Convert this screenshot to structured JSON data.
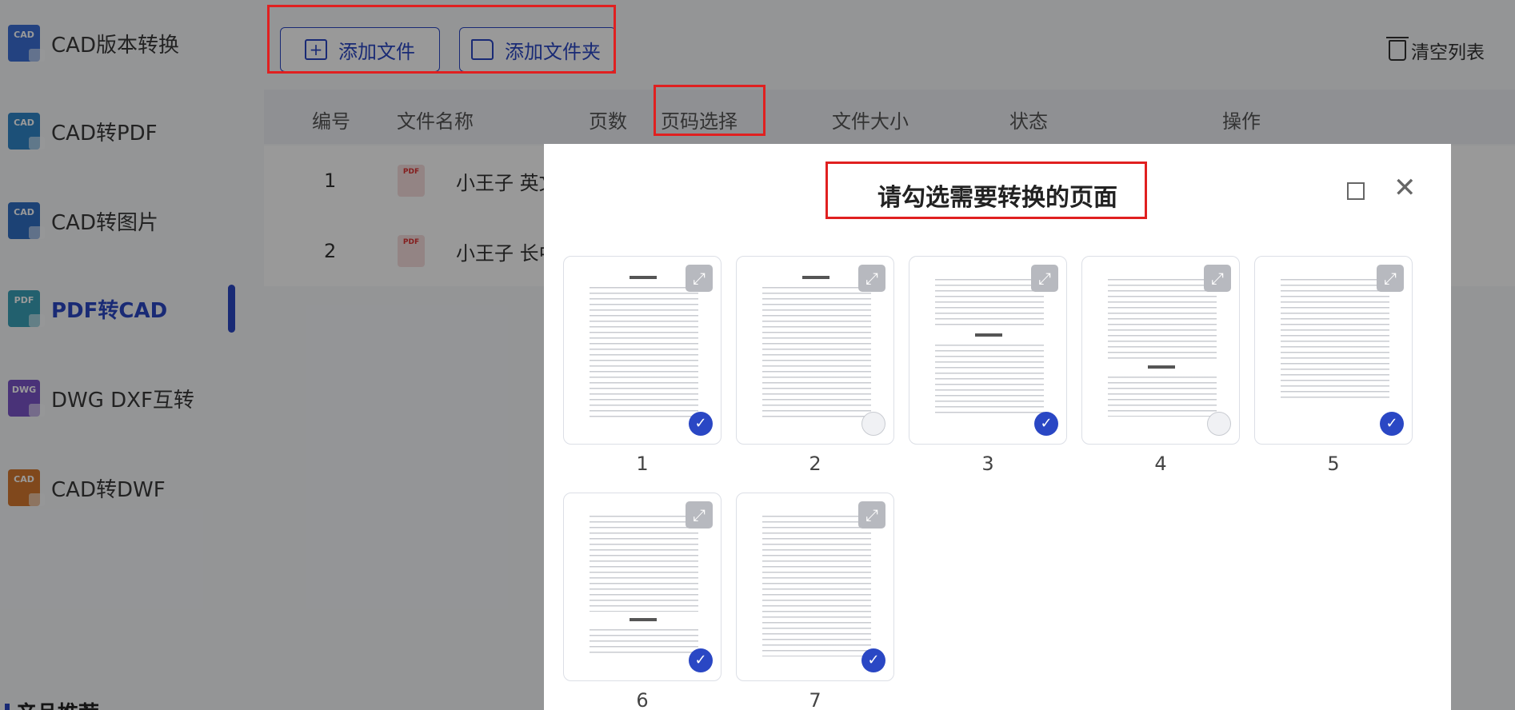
{
  "sidebar": {
    "items": [
      {
        "label": "CAD版本转换",
        "icon_text": "CAD",
        "color": "#3b6fd6",
        "active": false
      },
      {
        "label": "CAD转PDF",
        "icon_text": "CAD",
        "color": "#2f86c9",
        "active": false
      },
      {
        "label": "CAD转图片",
        "icon_text": "CAD",
        "color": "#2f6ec4",
        "active": false
      },
      {
        "label": "PDF转CAD",
        "icon_text": "PDF",
        "color": "#3aa0b8",
        "active": true
      },
      {
        "label": "DWG DXF互转",
        "icon_text": "DWG",
        "color": "#7b54c9",
        "active": false
      },
      {
        "label": "CAD转DWF",
        "icon_text": "CAD",
        "color": "#d6792f",
        "active": false
      }
    ],
    "section_label": "产品推荐"
  },
  "toolbar": {
    "add_file": "添加文件",
    "add_folder": "添加文件夹",
    "clear_list": "清空列表"
  },
  "table": {
    "headers": [
      "编号",
      "文件名称",
      "页数",
      "页码选择",
      "文件大小",
      "状态",
      "操作"
    ],
    "rows": [
      {
        "num": "1",
        "name": "小王子 英文",
        "icon_text": "PDF"
      },
      {
        "num": "2",
        "name": "小王子 长中",
        "icon_text": "PDF"
      }
    ]
  },
  "modal": {
    "title": "请勾选需要转换的页面",
    "pages": [
      {
        "number": "1",
        "selected": true
      },
      {
        "number": "2",
        "selected": false
      },
      {
        "number": "3",
        "selected": true
      },
      {
        "number": "4",
        "selected": false
      },
      {
        "number": "5",
        "selected": true
      },
      {
        "number": "6",
        "selected": true
      },
      {
        "number": "7",
        "selected": true
      }
    ]
  },
  "colors": {
    "accent": "#2a47c4",
    "highlight": "#e02020"
  }
}
